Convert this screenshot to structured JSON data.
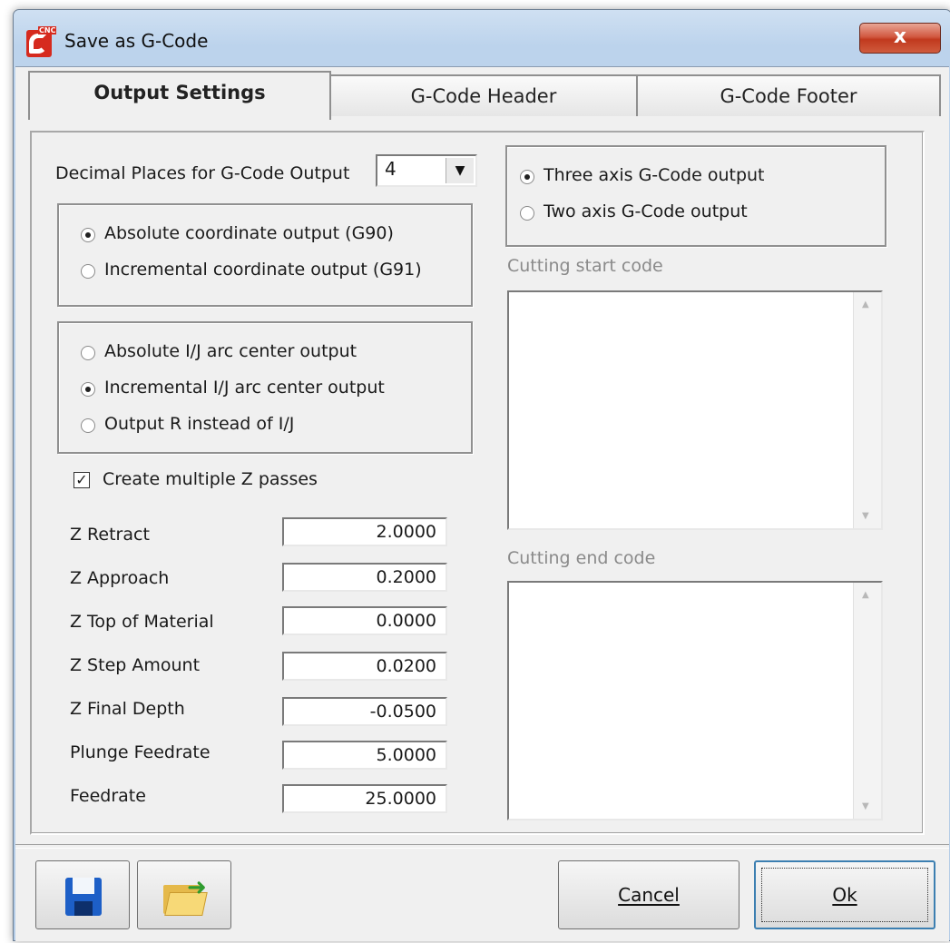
{
  "window": {
    "title": "Save as G-Code",
    "close_glyph": "x",
    "app_icon": "cnc-app-icon",
    "app_icon_text": "CNC"
  },
  "tabs": [
    {
      "label": "Output Settings",
      "active": true
    },
    {
      "label": "G-Code Header",
      "active": false
    },
    {
      "label": "G-Code Footer",
      "active": false
    }
  ],
  "output": {
    "decimal_label": "Decimal Places for G-Code Output",
    "decimal_value": "4",
    "coordinate_mode": [
      {
        "label": "Absolute coordinate output (G90)",
        "checked": true
      },
      {
        "label": "Incremental coordinate output (G91)",
        "checked": false
      }
    ],
    "arc_mode": [
      {
        "label": "Absolute I/J arc center output",
        "checked": false
      },
      {
        "label": "Incremental I/J arc center output",
        "checked": true
      },
      {
        "label": "Output R instead of I/J",
        "checked": false
      }
    ],
    "multiple_z": {
      "label": "Create multiple Z passes",
      "checked": true
    },
    "fields": [
      {
        "label": "Z Retract",
        "value": "2.0000"
      },
      {
        "label": "Z Approach",
        "value": "0.2000"
      },
      {
        "label": "Z Top of Material",
        "value": "0.0000"
      },
      {
        "label": "Z Step Amount",
        "value": "0.0200"
      },
      {
        "label": "Z Final Depth",
        "value": "-0.0500"
      },
      {
        "label": "Plunge Feedrate",
        "value": "5.0000"
      },
      {
        "label": "Feedrate",
        "value": "25.0000"
      }
    ],
    "axis_mode": [
      {
        "label": "Three axis G-Code output",
        "checked": true
      },
      {
        "label": "Two axis G-Code output",
        "checked": false
      }
    ],
    "cutting_start_label": "Cutting start code",
    "cutting_start_value": "",
    "cutting_end_label": "Cutting end code",
    "cutting_end_value": ""
  },
  "buttons": {
    "save_icon": "floppy-disk-icon",
    "open_icon": "open-folder-icon",
    "cancel": "Cancel",
    "ok": "Ok"
  },
  "colors": {
    "titlebar": "#bcd3ec",
    "close": "#c1391e",
    "client": "#f0f0f0",
    "save_icon": "#1d5fc7"
  }
}
